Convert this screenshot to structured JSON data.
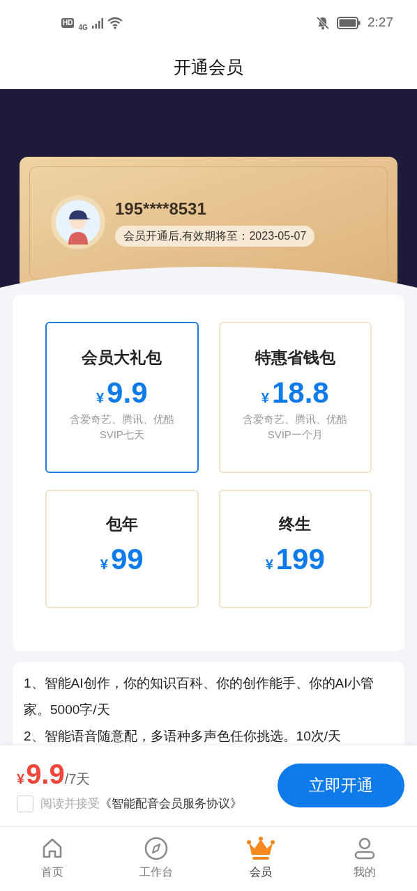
{
  "status_bar": {
    "hd": "HD",
    "network": "4G",
    "time": "2:27"
  },
  "title": "开通会员",
  "header": {
    "phone": "195****8531",
    "expiry": "会员开通后,有效期将至：2023-05-07"
  },
  "plans": [
    {
      "name": "会员大礼包",
      "currency": "¥",
      "price": "9.9",
      "desc": [
        "含爱奇艺、腾讯、优酷",
        "SVIP七天"
      ],
      "selected": true
    },
    {
      "name": "特惠省钱包",
      "currency": "¥",
      "price": "18.8",
      "desc": [
        "含爱奇艺、腾讯、优酷",
        "SVIP一个月"
      ],
      "selected": false
    },
    {
      "name": "包年",
      "currency": "¥",
      "price": "99",
      "selected": false
    },
    {
      "name": "终生",
      "currency": "¥",
      "price": "199",
      "selected": false
    }
  ],
  "benefits": [
    "1、智能AI创作，你的知识百科、你的创作能手、你的AI小管家。5000字/天",
    "2、智能语音随意配，多语种多声色任你挑选。10次/天"
  ],
  "purchase": {
    "currency": "¥",
    "price": "9.9",
    "period": "/7天",
    "agreement": {
      "checked": false,
      "prefix": "阅读并接受",
      "link": "《智能配音会员服务协议》"
    },
    "button": "立即开通"
  },
  "tabs": [
    {
      "label": "首页",
      "kind": "home",
      "selected": false
    },
    {
      "label": "工作台",
      "kind": "compass",
      "selected": false
    },
    {
      "label": "会员",
      "kind": "crown",
      "selected": true
    },
    {
      "label": "我的",
      "kind": "user",
      "selected": false
    }
  ]
}
